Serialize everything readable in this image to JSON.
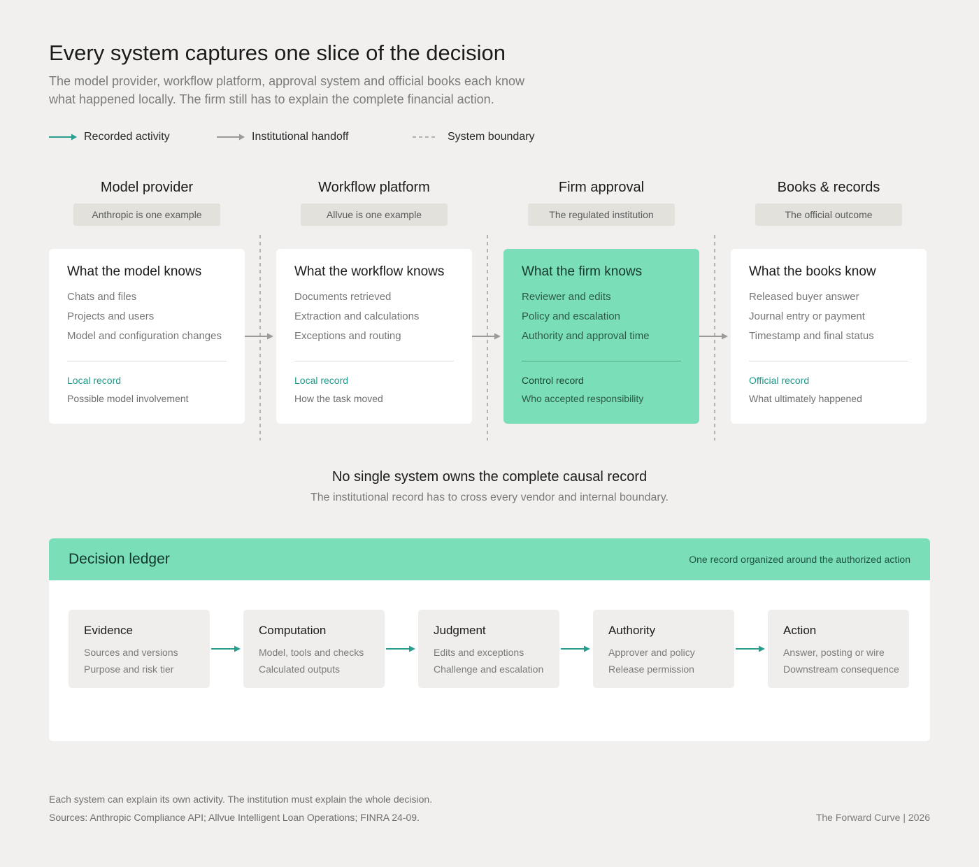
{
  "header": {
    "title": "Every system captures one slice of the decision",
    "subtitle": "The model provider, workflow platform, approval system and official books each know what happened locally. The firm still has to explain the complete financial action."
  },
  "legend": [
    {
      "label": "Recorded activity",
      "style": "teal-arrow",
      "color": "#2a9d8f"
    },
    {
      "label": "Institutional handoff",
      "style": "gray-arrow",
      "color": "#9a9a9a"
    },
    {
      "label": "System boundary",
      "style": "dashed-line",
      "color": "#b3b3b3"
    }
  ],
  "columns": [
    {
      "title": "Model provider",
      "pill": "Anthropic is one example",
      "card": {
        "title": "What the model knows",
        "items": [
          "Chats and files",
          "Projects and users",
          "Model and configuration changes"
        ],
        "record_label": "Local record",
        "record_desc": "Possible model involvement",
        "highlight": false
      }
    },
    {
      "title": "Workflow platform",
      "pill": "Allvue is one example",
      "card": {
        "title": "What the workflow knows",
        "items": [
          "Documents retrieved",
          "Extraction and calculations",
          "Exceptions and routing"
        ],
        "record_label": "Local record",
        "record_desc": "How the task moved",
        "highlight": false
      }
    },
    {
      "title": "Firm approval",
      "pill": "The regulated institution",
      "card": {
        "title": "What the firm knows",
        "items": [
          "Reviewer and edits",
          "Policy and escalation",
          "Authority and approval time"
        ],
        "record_label": "Control record",
        "record_desc": "Who accepted responsibility",
        "highlight": true
      }
    },
    {
      "title": "Books & records",
      "pill": "The official outcome",
      "card": {
        "title": "What the books know",
        "items": [
          "Released buyer answer",
          "Journal entry or payment",
          "Timestamp and final status"
        ],
        "record_label": "Official record",
        "record_desc": "What ultimately happened",
        "highlight": false
      }
    }
  ],
  "middle": {
    "title": "No single system owns the complete causal record",
    "subtitle": "The institutional record has to cross every vendor and internal boundary."
  },
  "ledger": {
    "title": "Decision ledger",
    "note": "One record organized around the authorized action",
    "steps": [
      {
        "title": "Evidence",
        "lines": [
          "Sources and versions",
          "Purpose and risk tier"
        ]
      },
      {
        "title": "Computation",
        "lines": [
          "Model, tools and checks",
          "Calculated outputs"
        ]
      },
      {
        "title": "Judgment",
        "lines": [
          "Edits and exceptions",
          "Challenge and escalation"
        ]
      },
      {
        "title": "Authority",
        "lines": [
          "Approver and policy",
          "Release permission"
        ]
      },
      {
        "title": "Action",
        "lines": [
          "Answer, posting or wire",
          "Downstream consequence"
        ]
      }
    ]
  },
  "footer": {
    "note": "Each system can explain its own activity. The institution must explain the whole decision.",
    "sources": "Sources: Anthropic Compliance API; Allvue Intelligent Loan Operations; FINRA 24-09.",
    "brand": "The Forward Curve | 2026"
  },
  "colors": {
    "accent": "#7adfb8",
    "teal": "#2a9d8f",
    "background": "#f1f0ee"
  }
}
